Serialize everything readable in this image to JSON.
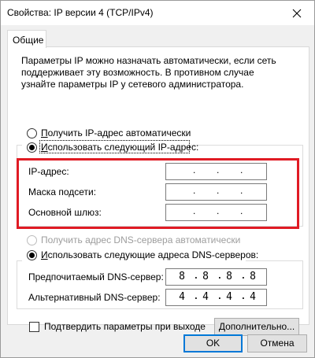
{
  "window": {
    "title": "Свойства: IP версии 4 (TCP/IPv4)",
    "close_icon": "close-icon"
  },
  "tabs": [
    {
      "label": "Общие"
    }
  ],
  "general": {
    "description": "Параметры IP можно назначать автоматически, если сеть поддерживает эту возможность. В противном случае узнайте параметры IP у сетевого администратора.",
    "ip": {
      "auto_label": "Получить IP-адрес автоматически",
      "manual_label": "Использовать следующий IP-адрес:",
      "selected": "manual",
      "fields": [
        {
          "label": "IP-адрес:",
          "value": [
            "",
            "",
            "",
            ""
          ]
        },
        {
          "label": "Маска подсети:",
          "value": [
            "",
            "",
            "",
            ""
          ]
        },
        {
          "label": "Основной шлюз:",
          "value": [
            "",
            "",
            "",
            ""
          ]
        }
      ]
    },
    "dns": {
      "auto_label": "Получить адрес DNS-сервера автоматически",
      "manual_label": "Использовать следующие адреса DNS-серверов:",
      "selected": "manual",
      "fields": [
        {
          "label": "Предпочитаемый DNS-сервер:",
          "value": [
            "8",
            "8",
            "8",
            "8"
          ]
        },
        {
          "label": "Альтернативный DNS-сервер:",
          "value": [
            "4",
            "4",
            "4",
            "4"
          ]
        }
      ]
    },
    "validate_label": "Подтвердить параметры при выходе",
    "validate_checked": false,
    "advanced_button": "Дополнительно..."
  },
  "footer": {
    "ok": "OK",
    "cancel": "Отмена"
  },
  "highlight_color": "#e01b24"
}
